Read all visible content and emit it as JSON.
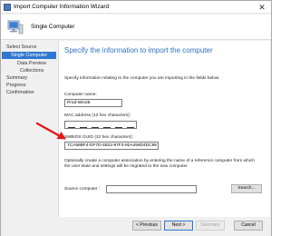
{
  "window": {
    "title": "Import Computer Information Wizard",
    "close_glyph": "✕"
  },
  "banner": {
    "title": "Single Computer"
  },
  "nav": {
    "items": [
      {
        "label": "Select Source"
      },
      {
        "label": "Single Computer"
      },
      {
        "label": "Data Preview"
      },
      {
        "label": "Collections"
      },
      {
        "label": "Summary"
      },
      {
        "label": "Progress"
      },
      {
        "label": "Confirmation"
      }
    ]
  },
  "main": {
    "heading": "Specify the information to import the computer",
    "intro": "Specify information relating to the computer you are importing in the fields below.",
    "computer_name_label": "Computer name:",
    "computer_name_value": "Prod-Win28",
    "mac_label": "MAC address (12 hex characters):",
    "smbios_label": "SMBIOS GUID (32 hex characters):",
    "smbios_value": "7CA58BF4-DF7D-4822-97F3-92A458D4DC89",
    "assoc_line1": "Optionally create a computer association by entering the name of a reference computer from which",
    "assoc_line2": "the user state and settings will be migrated to the new computer.",
    "source_label": "Source computer :",
    "source_value": "",
    "search_label": "Search..."
  },
  "footer": {
    "previous_label": "< Previous",
    "next_label": "Next >",
    "summary_label": "Summary",
    "cancel_label": "Cancel"
  },
  "colors": {
    "accent": "#2f77cf",
    "heading": "#2f70c4",
    "arrow": "#e01a1a"
  },
  "icons": {
    "title": "wizard-icon",
    "banner": "computer-icon",
    "arrow": "red-arrow-icon"
  }
}
